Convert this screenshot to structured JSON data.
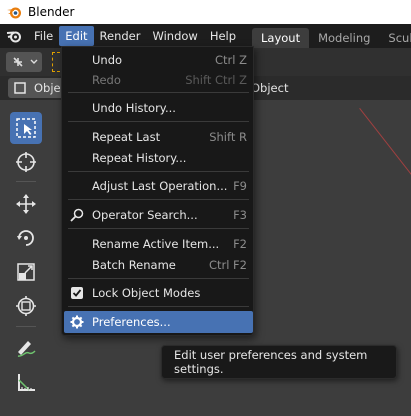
{
  "window": {
    "title": "Blender"
  },
  "menubar": {
    "menus": [
      "File",
      "Edit",
      "Render",
      "Window",
      "Help"
    ],
    "active_menu": "Edit",
    "workspaces": [
      "Layout",
      "Modeling",
      "Sculpt"
    ],
    "active_workspace": "Layout"
  },
  "viewport": {
    "object_mode_label": "Objec",
    "header_text": "Object"
  },
  "edit_menu": {
    "items": [
      {
        "label": "Undo",
        "shortcut": "Ctrl Z",
        "disabled": false
      },
      {
        "label": "Redo",
        "shortcut": "Shift Ctrl Z",
        "disabled": true
      },
      {
        "label": "Undo History...",
        "shortcut": "",
        "disabled": false
      },
      {
        "label": "Repeat Last",
        "shortcut": "Shift R",
        "disabled": false
      },
      {
        "label": "Repeat History...",
        "shortcut": "",
        "disabled": false
      },
      {
        "label": "Adjust Last Operation...",
        "shortcut": "F9",
        "disabled": false
      },
      {
        "label": "Operator Search...",
        "shortcut": "F3",
        "disabled": false
      },
      {
        "label": "Rename Active Item...",
        "shortcut": "F2",
        "disabled": false
      },
      {
        "label": "Batch Rename",
        "shortcut": "Ctrl F2",
        "disabled": false
      },
      {
        "label": "Lock Object Modes",
        "shortcut": "",
        "checked": true
      },
      {
        "label": "Preferences...",
        "shortcut": "",
        "highlighted": true
      }
    ]
  },
  "tooltip": {
    "text": "Edit user preferences and system settings."
  },
  "colors": {
    "accent": "#4772b3",
    "menubar_bg": "#1d1d1d",
    "menu_bg": "#181818"
  }
}
